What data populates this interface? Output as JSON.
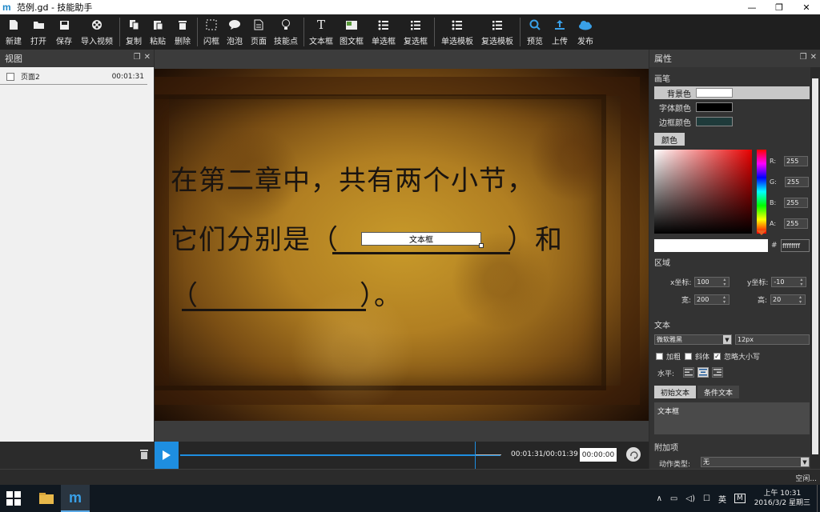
{
  "window": {
    "logo_text": "m",
    "title": "范例.gd - 技能助手",
    "minimize": "—",
    "restore": "❐",
    "close": "✕"
  },
  "toolbar": {
    "items": [
      {
        "label": "新建",
        "icon": "new-file-icon"
      },
      {
        "label": "打开",
        "icon": "folder-open-icon"
      },
      {
        "label": "保存",
        "icon": "save-icon"
      },
      {
        "label": "导入视频",
        "icon": "film-reel-icon"
      },
      {
        "label": "复制",
        "icon": "copy-icon"
      },
      {
        "label": "粘贴",
        "icon": "paste-icon"
      },
      {
        "label": "删除",
        "icon": "trash-icon"
      },
      {
        "label": "闪框",
        "icon": "dashed-frame-icon"
      },
      {
        "label": "泡泡",
        "icon": "speech-bubble-icon"
      },
      {
        "label": "页面",
        "icon": "page-icon"
      },
      {
        "label": "技能点",
        "icon": "lightbulb-icon"
      },
      {
        "label": "文本框",
        "icon": "text-icon"
      },
      {
        "label": "图文框",
        "icon": "image-text-icon"
      },
      {
        "label": "单选框",
        "icon": "radio-list-icon"
      },
      {
        "label": "复选框",
        "icon": "checkbox-list-icon"
      },
      {
        "label": "单选模板",
        "icon": "radio-template-icon"
      },
      {
        "label": "复选模板",
        "icon": "checkbox-template-icon"
      },
      {
        "label": "预览",
        "icon": "search-icon"
      },
      {
        "label": "上传",
        "icon": "upload-icon"
      },
      {
        "label": "发布",
        "icon": "cloud-publish-icon"
      }
    ]
  },
  "left_panel": {
    "title": "视图",
    "pages": [
      {
        "name": "页面2",
        "time": "00:01:31"
      }
    ]
  },
  "canvas": {
    "line1": "在第二章中，共有两个小节，",
    "line2a": "它们分别是（",
    "line2b": "）和",
    "line3a": "（",
    "line3b": "）。",
    "textbox_label": "文本框"
  },
  "timeline": {
    "time_display": "00:01:31/00:01:39",
    "time_input": "00:00:00"
  },
  "right_panel": {
    "title": "属性",
    "brush_title": "画笔",
    "color_rows": [
      {
        "name": "背景色",
        "swatch": "#ffffff"
      },
      {
        "name": "字体颜色",
        "swatch": "#000000"
      },
      {
        "name": "边框颜色",
        "swatch": "#1f3b3b"
      }
    ],
    "color_button": "颜色",
    "rgba": [
      {
        "label": "R:",
        "value": "255"
      },
      {
        "label": "G:",
        "value": "255"
      },
      {
        "label": "B:",
        "value": "255"
      },
      {
        "label": "A:",
        "value": "255"
      }
    ],
    "hash": "#",
    "hex": "ffffffff",
    "region_title": "区域",
    "x_label": "x坐标:",
    "x_value": "100",
    "y_label": "y坐标:",
    "y_value": "-10",
    "w_label": "宽:",
    "w_value": "200",
    "h_label": "高:",
    "h_value": "20",
    "text_title": "文本",
    "font_value": "微软雅黑",
    "size_value": "12px",
    "bold_label": "加粗",
    "italic_label": "斜体",
    "ignore_case_label": "忽略大小写",
    "bold_checked": false,
    "italic_checked": false,
    "ignore_case_checked": true,
    "halign_label": "水平:",
    "tab_initial": "初始文本",
    "tab_condition": "条件文本",
    "initial_text": "文本框",
    "extra_title": "附加项",
    "action_type_label": "动作类型:",
    "action_type_value": "无"
  },
  "status": {
    "text": "空闲..."
  },
  "taskbar": {
    "tray_ime": "英",
    "tray_m": "M",
    "clock_time": "上午 10:31",
    "clock_date": "2016/3/2 星期三"
  },
  "colors": {
    "accent": "#1e8ee0",
    "panel_bg": "#333333",
    "toolbar_bg": "#1f1f1f"
  }
}
